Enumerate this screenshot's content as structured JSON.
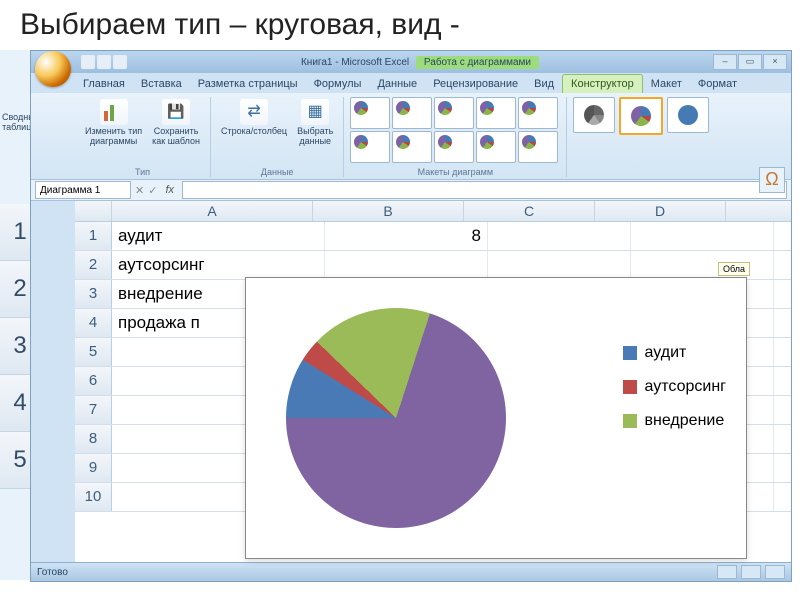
{
  "heading": "Выбираем тип – круговая, вид -",
  "titlebar": {
    "doc": "Книга1 - Microsoft Excel",
    "context": "Работа с диаграммами"
  },
  "tabs": [
    "Главная",
    "Вставка",
    "Разметка страницы",
    "Формулы",
    "Данные",
    "Рецензирование",
    "Вид",
    "Конструктор",
    "Макет",
    "Формат"
  ],
  "active_tab": 7,
  "ribbon": {
    "change_type": "Изменить тип\nдиаграммы",
    "save_tpl": "Сохранить\nкак шаблон",
    "group_type": "Тип",
    "swap": "Строка/столбец",
    "select": "Выбрать\nданные",
    "group_data": "Данные",
    "group_layouts": "Макеты диаграмм"
  },
  "namebox": "Диаграмма 1",
  "sidepanel": "Сводные\nтаблицы",
  "columns": [
    "A",
    "B",
    "C",
    "D"
  ],
  "rows": [
    {
      "n": 1,
      "A": "аудит",
      "B": "8"
    },
    {
      "n": 2,
      "A": "аутсорсинг",
      "B": ""
    },
    {
      "n": 3,
      "A": "внедрение",
      "B": ""
    },
    {
      "n": 4,
      "A": "продажа п",
      "B": ""
    },
    {
      "n": 5,
      "A": "",
      "B": ""
    },
    {
      "n": 6,
      "A": "",
      "B": ""
    },
    {
      "n": 7,
      "A": "",
      "B": ""
    },
    {
      "n": 8,
      "A": "",
      "B": ""
    },
    {
      "n": 9,
      "A": "",
      "B": ""
    },
    {
      "n": 10,
      "A": "",
      "B": ""
    }
  ],
  "leftstub_rows": [
    "1",
    "2",
    "3",
    "4",
    "5"
  ],
  "chart_tag": "Обла",
  "legend": [
    {
      "label": "аудит",
      "color": "#4a7ab5"
    },
    {
      "label": "аутсорсинг",
      "color": "#be4b48"
    },
    {
      "label": "внедрение",
      "color": "#9bbb59"
    }
  ],
  "status": "Готово",
  "chart_data": {
    "type": "pie",
    "title": "",
    "series": [
      {
        "name": "",
        "values": [
          8,
          3,
          16,
          63
        ]
      }
    ],
    "categories": [
      "аудит",
      "аутсорсинг",
      "внедрение",
      "продажа"
    ],
    "colors": [
      "#4a7ab5",
      "#be4b48",
      "#9bbb59",
      "#8064a2"
    ],
    "note": "approximate proportions estimated from slice angles"
  }
}
